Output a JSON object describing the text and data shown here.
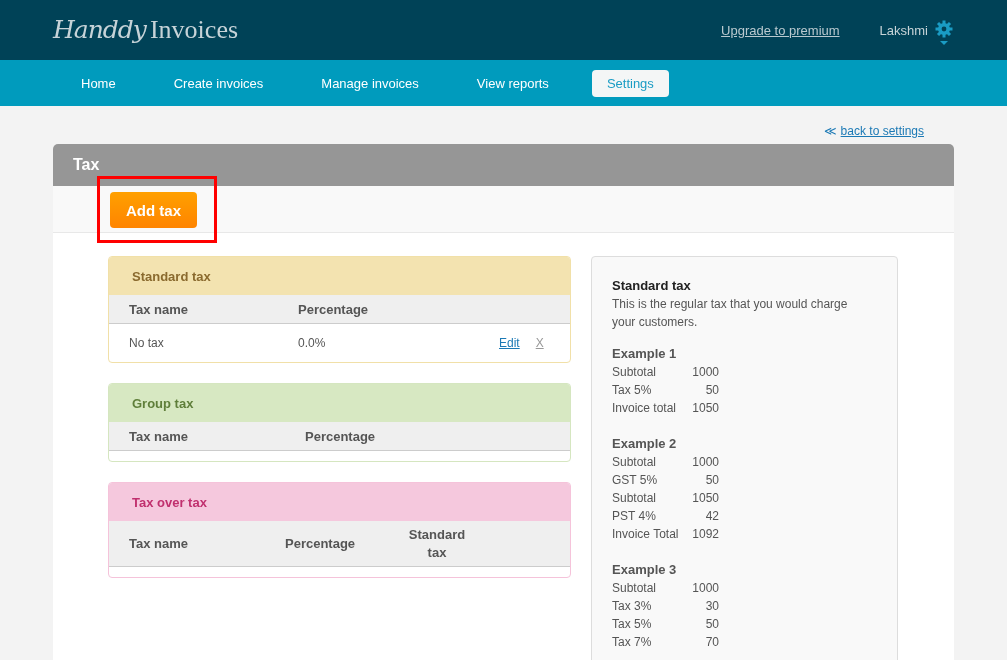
{
  "header": {
    "logo_script": "Handdy",
    "logo_text": "Invoices",
    "upgrade_link": "Upgrade to premium",
    "user": "Lakshmi"
  },
  "nav": [
    {
      "label": "Home",
      "selected": false
    },
    {
      "label": "Create invoices",
      "selected": false
    },
    {
      "label": "Manage invoices",
      "selected": false
    },
    {
      "label": "View reports",
      "selected": false
    },
    {
      "label": "Settings",
      "selected": true
    }
  ],
  "back_link": {
    "arrow": "≪",
    "label": "back to settings"
  },
  "panel": {
    "title": "Tax",
    "add_button": {
      "label": "Add tax",
      "highlighted": true
    }
  },
  "sections": [
    {
      "kind": "standard",
      "title": "Standard tax",
      "columns": [
        "Tax name",
        "Percentage"
      ],
      "rows": [
        {
          "name": "No tax",
          "percentage": "0.0%",
          "edit": "Edit",
          "delete": "X"
        }
      ]
    },
    {
      "kind": "group",
      "title": "Group tax",
      "columns": [
        "Tax name",
        "Percentage"
      ]
    },
    {
      "kind": "over",
      "title": "Tax over tax",
      "columns": [
        "Tax name",
        "Percentage",
        "Standard tax"
      ]
    }
  ],
  "info": {
    "title": "Standard tax",
    "description": "This is the regular tax that you would charge your customers.",
    "examples": [
      {
        "title": "Example 1",
        "lines": [
          [
            "Subtotal",
            "1000"
          ],
          [
            "Tax 5%",
            "50"
          ],
          [
            "Invoice total",
            "1050"
          ]
        ]
      },
      {
        "title": "Example 2",
        "lines": [
          [
            "Subtotal",
            "1000"
          ],
          [
            "GST 5%",
            "50"
          ],
          [
            "Subtotal",
            "1050"
          ],
          [
            "PST 4%",
            "42"
          ],
          [
            "Invoice Total",
            "1092"
          ]
        ]
      },
      {
        "title": "Example 3",
        "lines": [
          [
            "Subtotal",
            "1000"
          ],
          [
            "Tax 3%",
            "30"
          ],
          [
            "Tax 5%",
            "50"
          ],
          [
            "Tax 7%",
            "70"
          ]
        ]
      }
    ]
  }
}
